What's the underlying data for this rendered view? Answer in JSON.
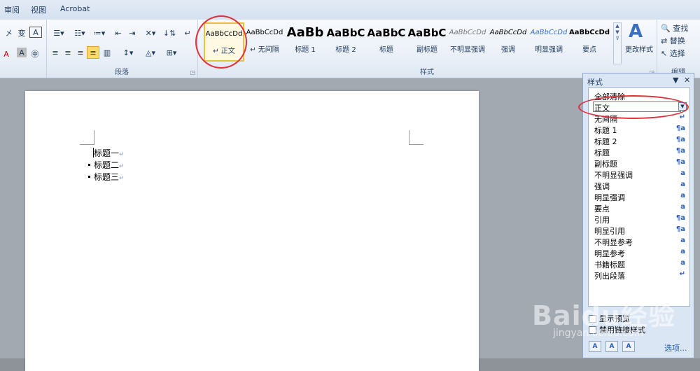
{
  "tabs": [
    "审阅",
    "视图",
    "Acrobat"
  ],
  "ribbon": {
    "paragraph_group_label": "段落",
    "styles_group_label": "样式",
    "editing_group_label": "编辑",
    "change_styles_label": "更改样式",
    "find_label": "查找",
    "replace_label": "替换",
    "select_label": "选择",
    "styles": [
      {
        "sample": "AaBbCcDd",
        "name": "正文",
        "active": true
      },
      {
        "sample": "AaBbCcDd",
        "name": "无间隔"
      },
      {
        "sample": "AaBb",
        "name": "标题 1"
      },
      {
        "sample": "AaBbC",
        "name": "标题 2"
      },
      {
        "sample": "AaBbC",
        "name": "标题"
      },
      {
        "sample": "AaBbC",
        "name": "副标题"
      },
      {
        "sample": "AaBbCcDd",
        "name": "不明显强调"
      },
      {
        "sample": "AaBbCcDd",
        "name": "强调"
      },
      {
        "sample": "AaBbCcDd",
        "name": "明显强调"
      },
      {
        "sample": "AaBbCcDd",
        "name": "要点"
      }
    ]
  },
  "document": {
    "lines": [
      "标题一",
      "标题二",
      "标题三"
    ]
  },
  "styles_pane": {
    "title": "样式",
    "clear_all": "全部清除",
    "items": [
      {
        "name": "正文",
        "type": "",
        "selected": true
      },
      {
        "name": "无间隔",
        "type": "↵"
      },
      {
        "name": "标题 1",
        "type": "¶a"
      },
      {
        "name": "标题 2",
        "type": "¶a"
      },
      {
        "name": "标题",
        "type": "¶a"
      },
      {
        "name": "副标题",
        "type": "¶a"
      },
      {
        "name": "不明显强调",
        "type": "a"
      },
      {
        "name": "强调",
        "type": "a"
      },
      {
        "name": "明显强调",
        "type": "a"
      },
      {
        "name": "要点",
        "type": "a"
      },
      {
        "name": "引用",
        "type": "¶a"
      },
      {
        "name": "明显引用",
        "type": "¶a"
      },
      {
        "name": "不明显参考",
        "type": "a"
      },
      {
        "name": "明显参考",
        "type": "a"
      },
      {
        "name": "书籍标题",
        "type": "a"
      },
      {
        "name": "列出段落",
        "type": "↵"
      }
    ],
    "show_preview": "显示预览",
    "disable_linked": "禁用链接样式",
    "options_link": "选项..."
  },
  "watermark": {
    "main": "Baidu经验",
    "sub": "jingyan.baidu.com"
  },
  "colors": {
    "accent": "#e0313a",
    "selection": "#fbd96a",
    "link": "#2a5fb4"
  }
}
